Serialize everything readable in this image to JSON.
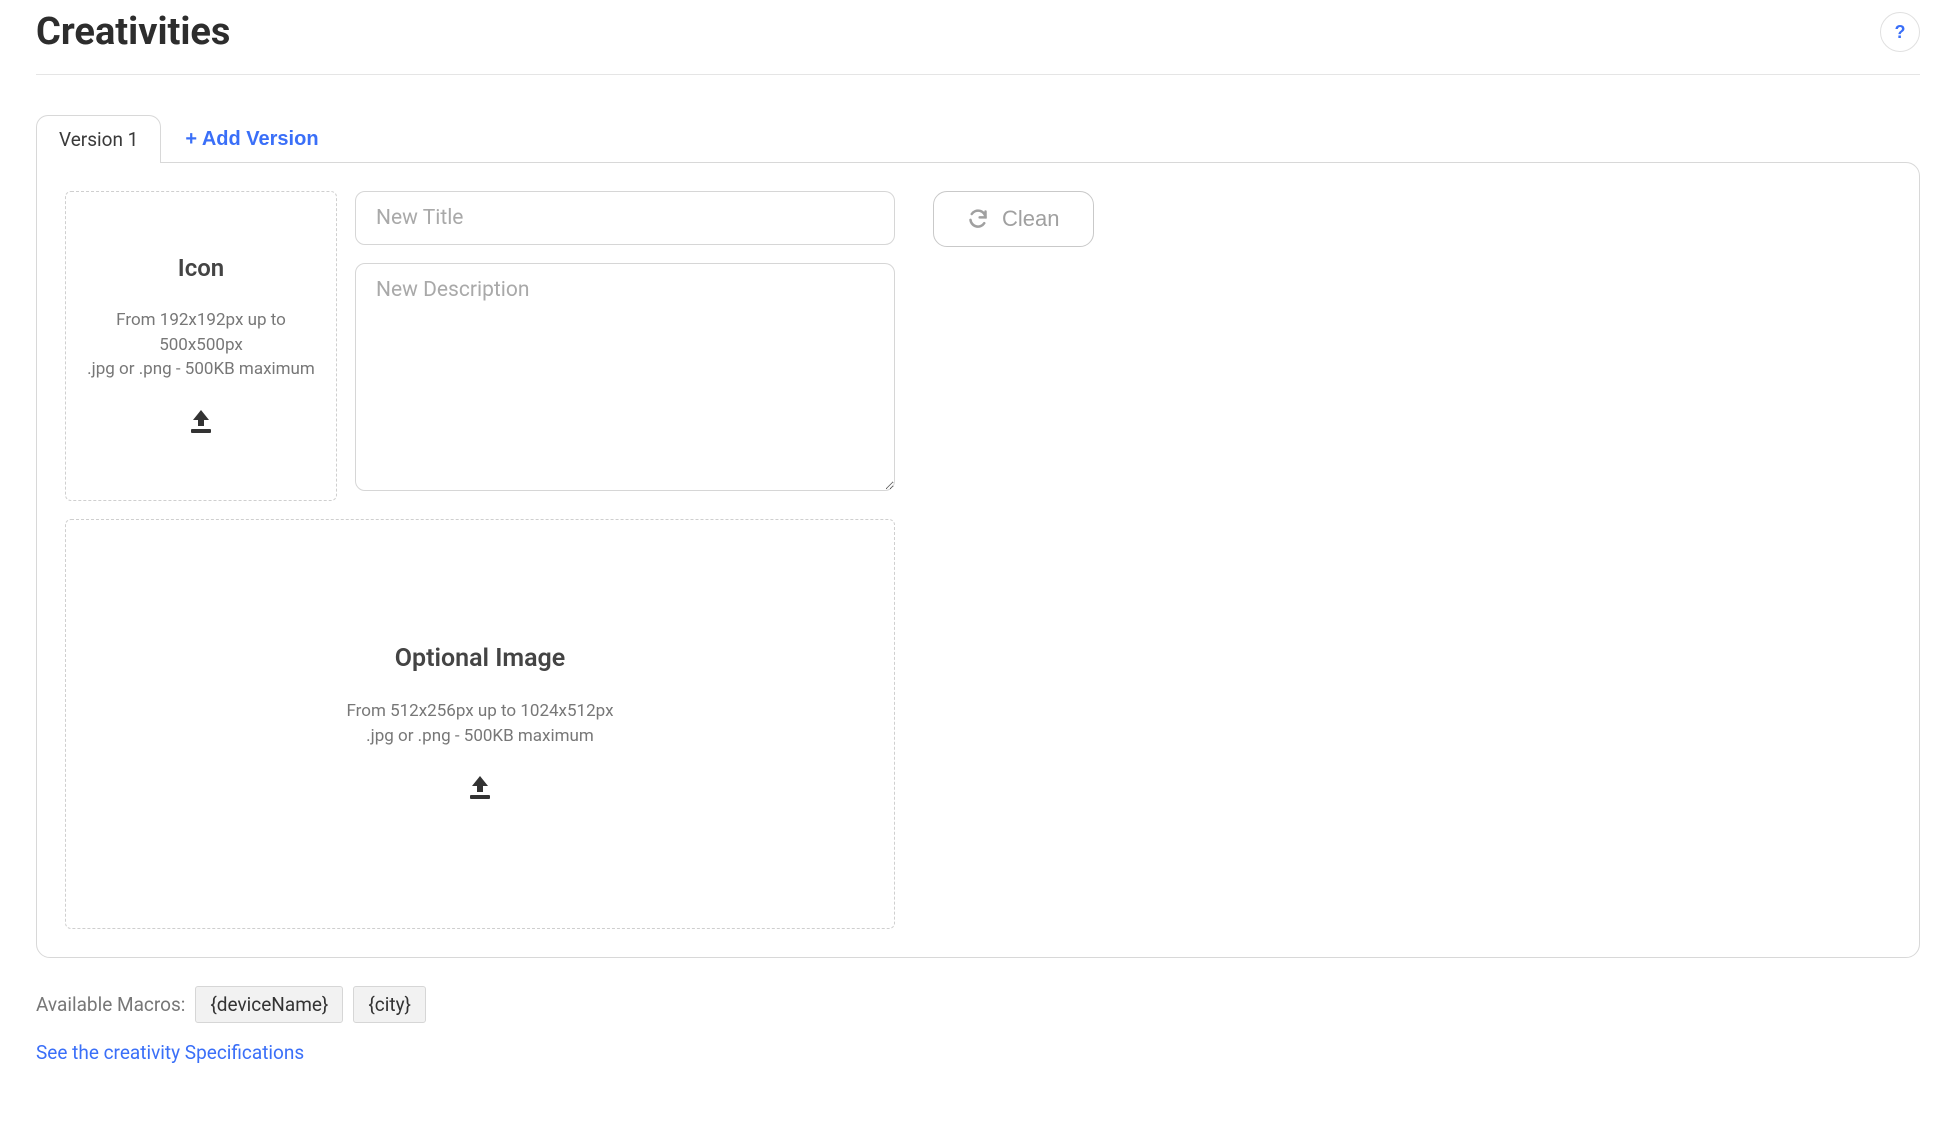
{
  "header": {
    "title": "Creativities",
    "help_icon": "?"
  },
  "tabs": {
    "active": "Version 1",
    "add_version_label": "+ Add Version"
  },
  "icon_upload": {
    "title": "Icon",
    "spec_line1": "From 192x192px up to 500x500px",
    "spec_line2": ".jpg or .png - 500KB maximum"
  },
  "fields": {
    "title_placeholder": "New Title",
    "description_placeholder": "New Description"
  },
  "clean_button": "Clean",
  "optional_image": {
    "title": "Optional Image",
    "spec_line1": "From 512x256px up to 1024x512px",
    "spec_line2": ".jpg or .png - 500KB maximum"
  },
  "macros": {
    "label": "Available Macros:",
    "items": [
      "{deviceName}",
      "{city}"
    ]
  },
  "spec_link": "See the creativity Specifications"
}
